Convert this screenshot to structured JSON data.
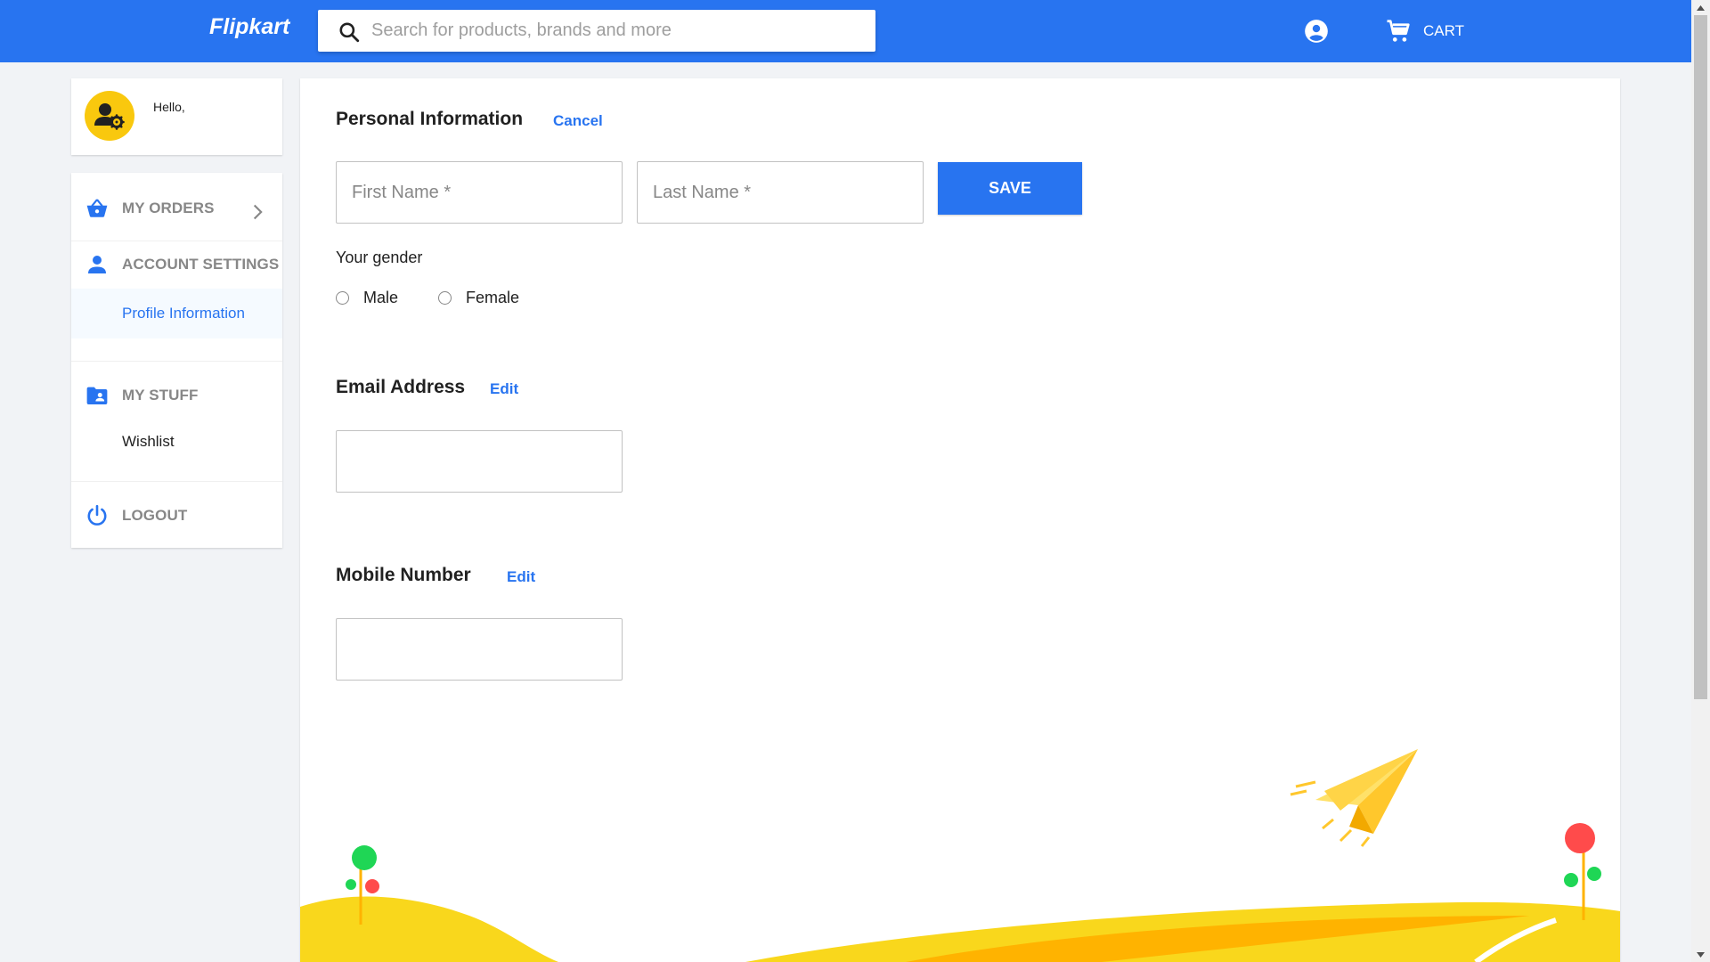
{
  "header": {
    "logo": "Flipkart",
    "search_placeholder": "Search for products, brands and more",
    "cart_label": "CART"
  },
  "sidebar": {
    "greeting": "Hello,",
    "my_orders": "MY ORDERS",
    "account_settings": "ACCOUNT SETTINGS",
    "profile_information": "Profile Information",
    "my_stuff": "MY STUFF",
    "wishlist": "Wishlist",
    "logout": "LOGOUT"
  },
  "main": {
    "personal_info_title": "Personal Information",
    "cancel_label": "Cancel",
    "first_name_placeholder": "First Name *",
    "last_name_placeholder": "Last Name *",
    "save_label": "SAVE",
    "gender_label": "Your gender",
    "gender_options": [
      "Male",
      "Female"
    ],
    "email_title": "Email Address",
    "email_edit": "Edit",
    "email_value": "",
    "mobile_title": "Mobile Number",
    "mobile_edit": "Edit",
    "mobile_value": ""
  },
  "colors": {
    "brand_blue": "#2874f0",
    "avatar_yellow": "#f9c80e",
    "page_bg": "#f1f3f6"
  }
}
